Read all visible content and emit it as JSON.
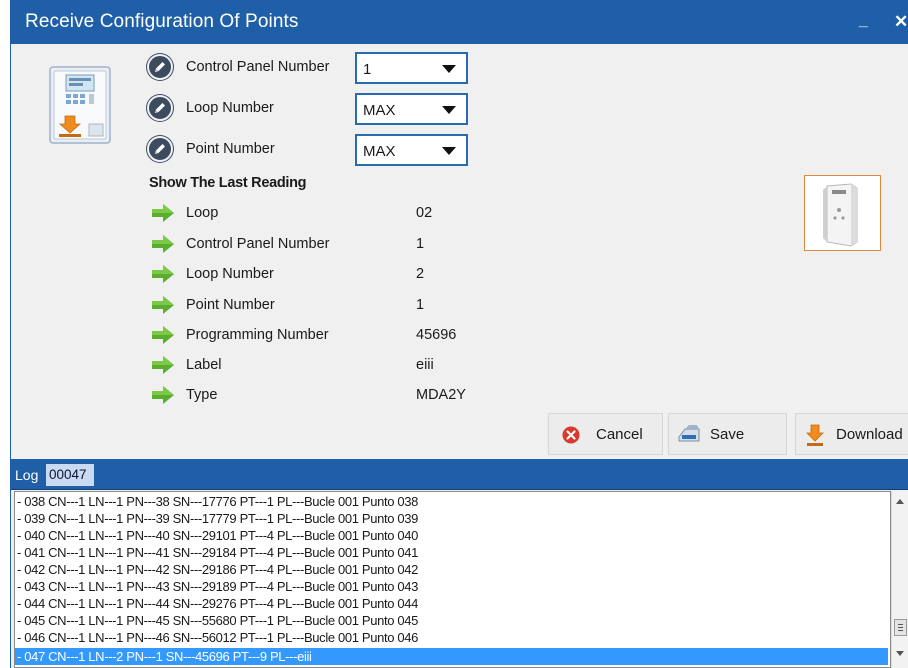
{
  "window": {
    "title": "Receive Configuration Of Points",
    "minimize_glyph": "_",
    "close_glyph": "✕"
  },
  "selectors": [
    {
      "label": "Control Panel Number",
      "value": "1",
      "icon": "pencil-icon"
    },
    {
      "label": "Loop Number",
      "value": "MAX",
      "icon": "pencil-icon"
    },
    {
      "label": "Point Number",
      "value": "MAX",
      "icon": "pencil-icon"
    }
  ],
  "last_reading": {
    "title": "Show The Last Reading",
    "items": [
      {
        "label": "Loop",
        "value": "02"
      },
      {
        "label": "Control Panel Number",
        "value": "1"
      },
      {
        "label": "Loop Number",
        "value": "2"
      },
      {
        "label": "Point Number",
        "value": "1"
      },
      {
        "label": "Programming Number",
        "value": "45696"
      },
      {
        "label": "Label",
        "value": "eiii"
      },
      {
        "label": "Type",
        "value": "MDA2Y"
      }
    ]
  },
  "buttons": {
    "cancel": "Cancel",
    "save": "Save",
    "download": "Download"
  },
  "log": {
    "label": "Log",
    "count": "00047",
    "lines": [
      "- 038 CN---1 LN---1 PN---38 SN---17776 PT---1 PL---Bucle 001 Punto 038",
      "- 039 CN---1 LN---1 PN---39 SN---17779 PT---1 PL---Bucle 001 Punto 039",
      "- 040 CN---1 LN---1 PN---40 SN---29101 PT---4 PL---Bucle 001 Punto 040",
      "- 041 CN---1 LN---1 PN---41 SN---29184 PT---4 PL---Bucle 001 Punto 041",
      "- 042 CN---1 LN---1 PN---42 SN---29186 PT---4 PL---Bucle 001 Punto 042",
      "- 043 CN---1 LN---1 PN---43 SN---29189 PT---4 PL---Bucle 001 Punto 043",
      "- 044 CN---1 LN---1 PN---44 SN---29276 PT---4 PL---Bucle 001 Punto 044",
      "- 045 CN---1 LN---1 PN---45 SN---55680 PT---1 PL---Bucle 001 Punto 045",
      "- 046 CN---1 LN---1 PN---46 SN---56012 PT---1 PL---Bucle 001 Punto 046",
      "- 047 CN---1 LN---2 PN---1 SN---45696 PT---9 PL---eiii"
    ],
    "selected_index": 9
  },
  "colors": {
    "titlebar": "#1f5fa8",
    "selection": "#3399ff",
    "arrow_green": "#5aae2e",
    "accent_orange": "#e08a3c"
  }
}
